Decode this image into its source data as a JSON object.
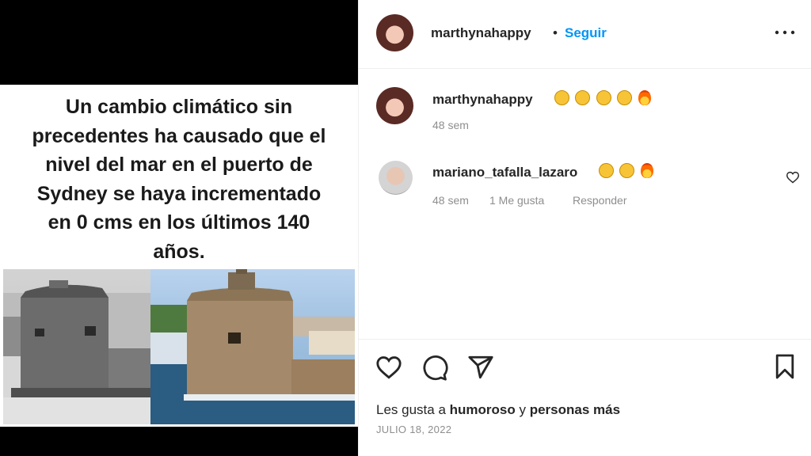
{
  "meme": {
    "lines": [
      "Un cambio climático sin",
      "precedentes ha causado que el",
      "nivel del mar en el puerto de",
      "Sydney se haya incrementado",
      "en 0 cms en los últimos 140",
      "años."
    ]
  },
  "header": {
    "username": "marthynahappy",
    "separator": "•",
    "follow_label": "Seguir",
    "more_icon": "more-options-icon"
  },
  "comments": [
    {
      "username": "marthynahappy",
      "emojis": [
        "smirk",
        "smirk",
        "smirk",
        "laugh-tears",
        "fire"
      ],
      "time": "48 sem"
    },
    {
      "username": "mariano_tafalla_lazaro",
      "emojis": [
        "laugh",
        "laugh",
        "fire"
      ],
      "time": "48 sem",
      "likes": "1 Me gusta",
      "reply_label": "Responder"
    }
  ],
  "actions": {
    "likes_prefix": "Les gusta a",
    "likes_user": "humoroso",
    "likes_conj": "y",
    "likes_others": "personas más",
    "date": "JULIO 18, 2022"
  }
}
